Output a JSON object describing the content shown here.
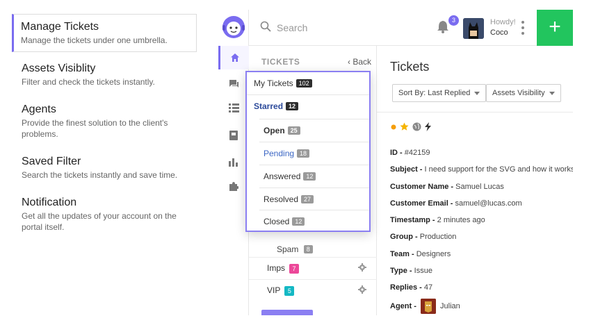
{
  "features": [
    {
      "title": "Manage Tickets",
      "desc": "Manage the tickets under one umbrella."
    },
    {
      "title": "Assets Visiblity",
      "desc": "Filter and check the tickets instantly."
    },
    {
      "title": "Agents",
      "desc": "Provide the finest solution to the client's problems."
    },
    {
      "title": "Saved Filter",
      "desc": "Search the tickets instantly and save time."
    },
    {
      "title": "Notification",
      "desc": "Get all the updates of your account on the portal itself."
    }
  ],
  "topbar": {
    "search_placeholder": "Search",
    "notification_count": "3",
    "howdy": "Howdy!",
    "username": "Coco",
    "add_label": "+"
  },
  "tickets_panel": {
    "heading": "TICKETS",
    "back_label": "Back",
    "spam": {
      "label": "Spam",
      "count": "8"
    },
    "labels": [
      {
        "name": "Imps",
        "count": "7",
        "color": "#ec4899"
      },
      {
        "name": "VIP",
        "count": "5",
        "color": "#14b8c4"
      }
    ]
  },
  "dropdown": {
    "my_tickets": {
      "label": "My Tickets",
      "count": "102"
    },
    "starred": {
      "label": "Starred",
      "count": "12"
    },
    "statuses": [
      {
        "label": "Open",
        "count": "25"
      },
      {
        "label": "Pending",
        "count": "18"
      },
      {
        "label": "Answered",
        "count": "12"
      },
      {
        "label": "Resolved",
        "count": "27"
      },
      {
        "label": "Closed",
        "count": "12"
      }
    ]
  },
  "detail": {
    "title": "Tickets",
    "sort_label": "Sort By: Last Replied",
    "assets_label": "Assets Visibility",
    "id_label": "ID -",
    "id_value": "#42159",
    "subject_label": "Subject -",
    "subject_value": "I need support for the SVG and how it works?",
    "customer_name_label": "Customer Name -",
    "customer_name_value": "Samuel Lucas",
    "customer_email_label": "Customer Email -",
    "customer_email_value": "samuel@lucas.com",
    "timestamp_label": "Timestamp -",
    "timestamp_value": "2 minutes ago",
    "group_label": "Group -",
    "group_value": "Production",
    "team_label": "Team -",
    "team_value": "Designers",
    "type_label": "Type -",
    "type_value": "Issue",
    "replies_label": "Replies -",
    "replies_value": "47",
    "agent_label": "Agent -",
    "agent_value": "Julian"
  },
  "colors": {
    "accent": "#7a6cf0",
    "add_button": "#22c55e",
    "pending_text": "#3b66c4",
    "starred_text": "#2c4a9a"
  },
  "icons": [
    "logo-icon",
    "home-icon",
    "chat-icon",
    "list-icon",
    "book-icon",
    "chart-icon",
    "puzzle-icon",
    "search-icon",
    "bell-icon",
    "kebab-icon",
    "settings-icon",
    "dot-icon",
    "star-icon",
    "globe-icon",
    "bolt-icon"
  ]
}
